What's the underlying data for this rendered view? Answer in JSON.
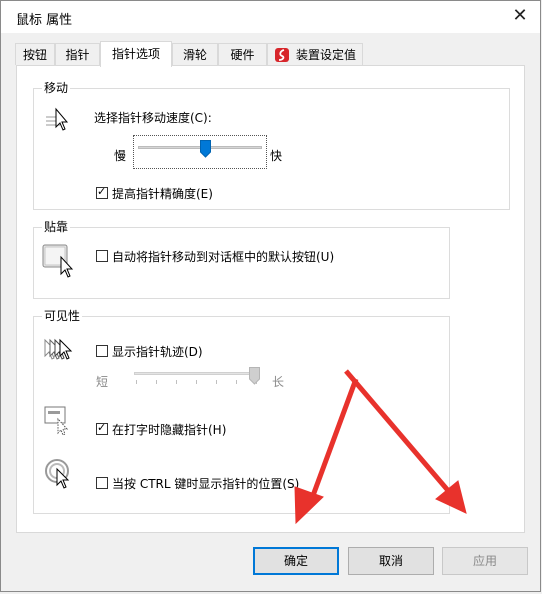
{
  "window": {
    "title": "鼠标 属性"
  },
  "tabs": [
    {
      "label": "按钮"
    },
    {
      "label": "指针"
    },
    {
      "label": "指针选项"
    },
    {
      "label": "滑轮"
    },
    {
      "label": "硬件"
    },
    {
      "label": "装置设定值"
    }
  ],
  "motion": {
    "group_label": "移动",
    "speed_label": "选择指针移动速度(C):",
    "slow_label": "慢",
    "fast_label": "快",
    "speed_level": 0.55,
    "precision_label": "提高指针精确度(E)",
    "precision_checked": true
  },
  "snap": {
    "group_label": "贴靠",
    "snapto_label": "自动将指针移动到对话框中的默认按钮(U)",
    "snapto_checked": false
  },
  "visibility": {
    "group_label": "可见性",
    "trails_label": "显示指针轨迹(D)",
    "trails_checked": false,
    "short_label": "短",
    "long_label": "长",
    "trail_level": 1.0,
    "hide_typing_label": "在打字时隐藏指针(H)",
    "hide_typing_checked": true,
    "ctrl_label": "当按 CTRL 键时显示指针的位置(S)",
    "ctrl_checked": false
  },
  "buttons": {
    "ok": "确定",
    "cancel": "取消",
    "apply": "应用"
  },
  "colors": {
    "accent": "#0078d7",
    "annotation_arrow": "#e8322c"
  }
}
